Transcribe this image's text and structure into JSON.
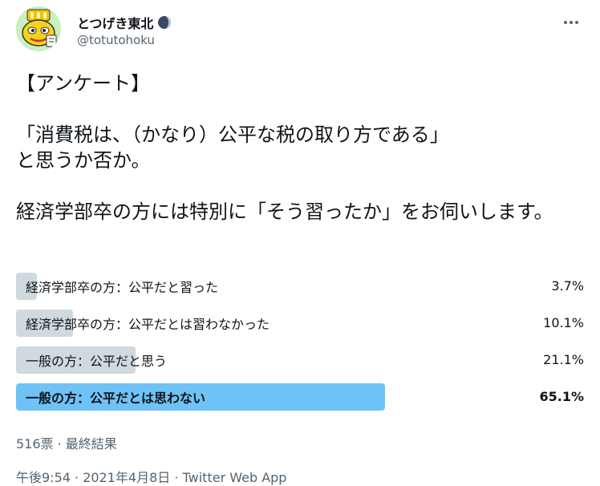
{
  "user": {
    "display_name": "とつげき東北",
    "handle": "@totutohoku"
  },
  "tweet": {
    "text": "【アンケート】\n\n「消費税は、（かなり）公平な税の取り方である」\nと思うか否か。\n\n経済学部卒の方には特別に「そう習ったか」をお伺いします。"
  },
  "poll": {
    "options": [
      {
        "label": "経済学部卒の方：公平だと習った",
        "percent_label": "3.7%",
        "percent": 3.7
      },
      {
        "label": "経済学部卒の方：公平だとは習わなかった",
        "percent_label": "10.1%",
        "percent": 10.1
      },
      {
        "label": "一般の方：公平だと思う",
        "percent_label": "21.1%",
        "percent": 21.1
      },
      {
        "label": "一般の方：公平だとは思わない",
        "percent_label": "65.1%",
        "percent": 65.1
      }
    ],
    "meta": "516票 · 最終結果"
  },
  "timestamp": "午後9:54 · 2021年4月8日 · Twitter Web App",
  "colors": {
    "bar": "#cfd9de",
    "winner_bar": "#6fc2f5",
    "secondary_text": "#536471"
  },
  "icons": [
    "avatar-image",
    "moon-icon",
    "more-icon"
  ]
}
